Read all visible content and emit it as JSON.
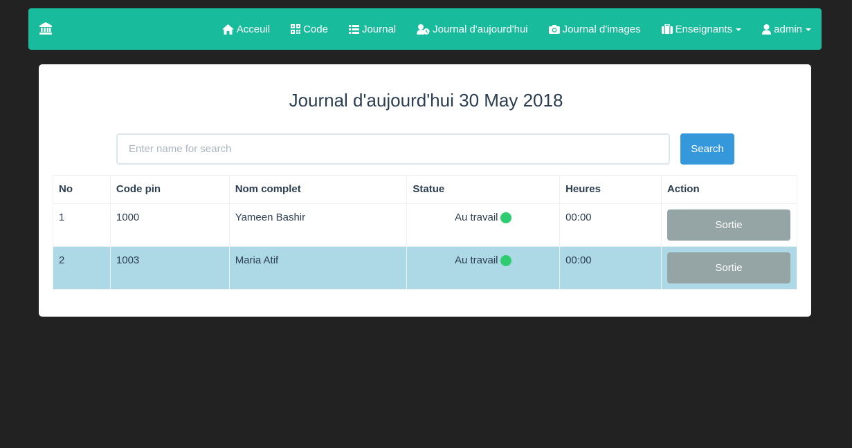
{
  "navbar": {
    "brand_icon": "bank-icon",
    "background": "#18bc9c",
    "items": [
      {
        "label": "Acceuil",
        "icon": "home-icon"
      },
      {
        "label": "Code",
        "icon": "qrcode-icon"
      },
      {
        "label": "Journal",
        "icon": "list-icon"
      },
      {
        "label": "Journal d'aujourd'hui",
        "icon": "user-clock-icon"
      },
      {
        "label": "Journal d'images",
        "icon": "camera-icon"
      },
      {
        "label": "Enseignants",
        "icon": "briefcase-icon",
        "dropdown": true
      },
      {
        "label": "admin",
        "icon": "user-icon",
        "dropdown": true
      }
    ]
  },
  "page": {
    "title": "Journal d'aujourd'hui 30 May 2018"
  },
  "search": {
    "placeholder": "Enter name for search",
    "value": "",
    "button_label": "Search"
  },
  "table": {
    "headers": [
      "No",
      "Code pin",
      "Nom complet",
      "Statue",
      "Heures",
      "Action"
    ],
    "rows": [
      {
        "no": "1",
        "code_pin": "1000",
        "name": "Yameen Bashir",
        "status": "Au travail",
        "status_color": "#2ecc71",
        "hours": "00:00",
        "action": "Sortie",
        "highlighted": false
      },
      {
        "no": "2",
        "code_pin": "1003",
        "name": "Maria Atif",
        "status": "Au travail",
        "status_color": "#2ecc71",
        "hours": "00:00",
        "action": "Sortie",
        "highlighted": true
      }
    ]
  }
}
